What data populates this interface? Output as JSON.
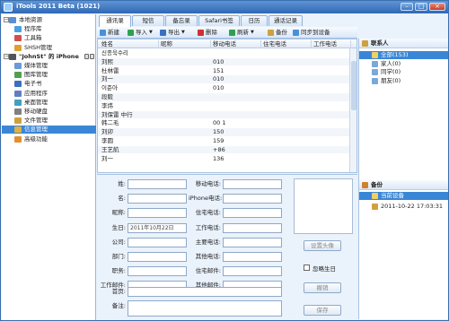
{
  "window": {
    "title": "iTools 2011 Beta (1021)",
    "buttons": [
      "–",
      "□",
      "×"
    ]
  },
  "sidebar": {
    "items": [
      {
        "label": "本地资源",
        "icon": "computer-icon",
        "color": "#5a8fd0",
        "indent": 0,
        "toggle": "−"
      },
      {
        "label": "程序库",
        "icon": "app-library-icon",
        "color": "#4aa0e0",
        "indent": 1
      },
      {
        "label": "工具箱",
        "icon": "toolbox-icon",
        "color": "#d05050",
        "indent": 1
      },
      {
        "label": "SHSH管理",
        "icon": "shsh-icon",
        "color": "#e0a030",
        "indent": 1
      },
      {
        "label": "\"JohnSt\" 的 iPhone",
        "icon": "iphone-icon",
        "color": "#555555",
        "indent": 0,
        "toggle": "−",
        "bold": true
      },
      {
        "label": "媒体管理",
        "icon": "media-icon",
        "color": "#6a9ad8",
        "indent": 1
      },
      {
        "label": "图库管理",
        "icon": "photo-library-icon",
        "color": "#50a050",
        "indent": 1
      },
      {
        "label": "电子书",
        "icon": "ebook-icon",
        "color": "#3a70c0",
        "indent": 1
      },
      {
        "label": "应用程序",
        "icon": "apps-icon",
        "color": "#6080c0",
        "indent": 1
      },
      {
        "label": "桌面管理",
        "icon": "desktop-icon",
        "color": "#40a0c0",
        "indent": 1
      },
      {
        "label": "移动硬盘",
        "icon": "disk-icon",
        "color": "#808080",
        "indent": 1
      },
      {
        "label": "文件管理",
        "icon": "folder-icon",
        "color": "#d0a040",
        "indent": 1
      },
      {
        "label": "信息管理",
        "icon": "contacts-icon",
        "color": "#e0b040",
        "indent": 1,
        "selected": true
      },
      {
        "label": "高级功能",
        "icon": "advanced-icon",
        "color": "#e09030",
        "indent": 1
      }
    ]
  },
  "tabs": [
    {
      "label": "通讯录",
      "active": true
    },
    {
      "label": "短信"
    },
    {
      "label": "备忘录"
    },
    {
      "label": "Safari书签"
    },
    {
      "label": "日历"
    },
    {
      "label": "通话记录"
    }
  ],
  "toolbar": [
    {
      "label": "新建",
      "icon": "new-icon",
      "color": "#4a90d9"
    },
    {
      "label": "导入",
      "icon": "import-icon",
      "color": "#30a050",
      "dropdown": true
    },
    {
      "label": "导出",
      "icon": "export-icon",
      "color": "#3a70c0",
      "dropdown": true
    },
    {
      "label": "删除",
      "icon": "delete-icon",
      "color": "#d03030"
    },
    {
      "label": "刷新",
      "icon": "refresh-icon",
      "color": "#30a050",
      "dropdown": true
    },
    {
      "label": "备份",
      "icon": "backup-icon",
      "color": "#d0a040"
    },
    {
      "label": "同步到设备",
      "icon": "sync-icon",
      "color": "#4a90d9"
    }
  ],
  "table": {
    "columns": [
      "姓名",
      "昵称",
      "移动电话",
      "住宅电话",
      "工作电话"
    ],
    "rows": [
      [
        "신종욱수리",
        "",
        "",
        "",
        ""
      ],
      [
        "刘熙",
        "",
        "010",
        "",
        ""
      ],
      [
        "杜林雷",
        "",
        "151",
        "",
        ""
      ],
      [
        "刘一",
        "",
        "010",
        "",
        ""
      ],
      [
        "이준아",
        "",
        "010",
        "",
        ""
      ],
      [
        "段毅",
        "",
        "",
        "",
        ""
      ],
      [
        "李炜",
        "",
        "",
        "",
        ""
      ],
      [
        "刘保雷 中行",
        "",
        "",
        "",
        ""
      ],
      [
        "韩二毛",
        "",
        "00 1",
        "",
        ""
      ],
      [
        "刘卯",
        "",
        "150",
        "",
        ""
      ],
      [
        "李圆",
        "",
        "159",
        "",
        ""
      ],
      [
        "王艺航",
        "",
        "+86",
        "",
        ""
      ],
      [
        "刘一",
        "",
        "136",
        "",
        ""
      ]
    ]
  },
  "groups": {
    "header": "联系人",
    "items": [
      {
        "label": "全部(153)",
        "icon": "group-all-icon",
        "selected": true
      },
      {
        "label": "家人(0)",
        "icon": "group-icon"
      },
      {
        "label": "同学(0)",
        "icon": "group-icon"
      },
      {
        "label": "朋友(0)",
        "icon": "group-icon"
      }
    ]
  },
  "backups": {
    "header": "备份",
    "items": [
      {
        "label": "当前设备",
        "icon": "device-icon",
        "selected": true
      },
      {
        "label": "2011-10-22 17:03:31",
        "icon": "backup-file-icon"
      }
    ]
  },
  "form": {
    "left": [
      {
        "label": "姓:",
        "value": ""
      },
      {
        "label": "名:",
        "value": ""
      },
      {
        "label": "昵称:",
        "value": ""
      },
      {
        "label": "生日:",
        "value": "2011年10月22日",
        "dropdown": true
      },
      {
        "label": "公司:",
        "value": ""
      },
      {
        "label": "部门:",
        "value": ""
      },
      {
        "label": "职务:",
        "value": ""
      },
      {
        "label": "工作邮件:",
        "value": ""
      }
    ],
    "right": [
      {
        "label": "移动电话:",
        "value": ""
      },
      {
        "label": "iPhone电话:",
        "value": ""
      },
      {
        "label": "住宅电话:",
        "value": ""
      },
      {
        "label": "工作电话:",
        "value": ""
      },
      {
        "label": "主要电话:",
        "value": ""
      },
      {
        "label": "其他电话:",
        "value": ""
      },
      {
        "label": "住宅邮件:",
        "value": ""
      },
      {
        "label": "其他邮件:",
        "value": ""
      }
    ],
    "homepage_label": "首页:",
    "notes_label": "备注:",
    "set_photo_button": "设置头像",
    "ignore_birthday_label": "忽略生日",
    "cancel_button": "撤销",
    "save_button": "保存"
  }
}
